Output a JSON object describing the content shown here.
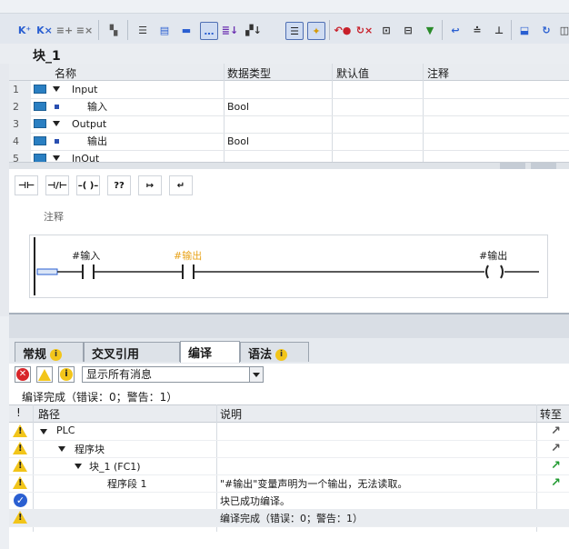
{
  "block_title": "块_1",
  "interface": {
    "headers": [
      "名称",
      "数据类型",
      "默认值",
      "注释"
    ],
    "rows": [
      {
        "num": "1",
        "name": "Input",
        "type": "",
        "expand": true
      },
      {
        "num": "2",
        "name": "输入",
        "type": "Bool",
        "expand": false
      },
      {
        "num": "3",
        "name": "Output",
        "type": "",
        "expand": true
      },
      {
        "num": "4",
        "name": "输出",
        "type": "Bool",
        "expand": false
      },
      {
        "num": "5",
        "name": "InOut",
        "type": "",
        "expand": true
      }
    ]
  },
  "ladder": {
    "tools": [
      "⊣⊢",
      "⊣/⊢",
      "–( )–",
      "??",
      "↦",
      "↵"
    ],
    "comment_label": "注释",
    "contact1_label": "#输入",
    "contact2_label": "#输出",
    "coil_label": "#输出",
    "contact2_label_color": "#e8a31a"
  },
  "tabs": [
    {
      "label": "常规",
      "info": true
    },
    {
      "label": "交叉引用",
      "info": false
    },
    {
      "label": "编译",
      "info": false,
      "active": true
    },
    {
      "label": "语法",
      "info": true
    }
  ],
  "messages": {
    "filter": "显示所有消息",
    "summary": "编译完成（错误：0；警告：1）",
    "headers": {
      "bang": "!",
      "path": "路径",
      "desc": "说明",
      "goto": "转至"
    },
    "rows": [
      {
        "icon": "warn",
        "path": "PLC",
        "desc": ""
      },
      {
        "icon": "warn",
        "path": "程序块",
        "desc": ""
      },
      {
        "icon": "warn",
        "path": "块_1 (FC1)",
        "desc": ""
      },
      {
        "icon": "warn",
        "path": "程序段 1",
        "desc": "\"#输出\"变量声明为一个输出，无法读取。"
      },
      {
        "icon": "ok",
        "path": "",
        "desc": "块已成功编译。"
      },
      {
        "icon": "warn",
        "path": "",
        "desc": "编译完成（错误：0；警告：1）"
      }
    ]
  }
}
